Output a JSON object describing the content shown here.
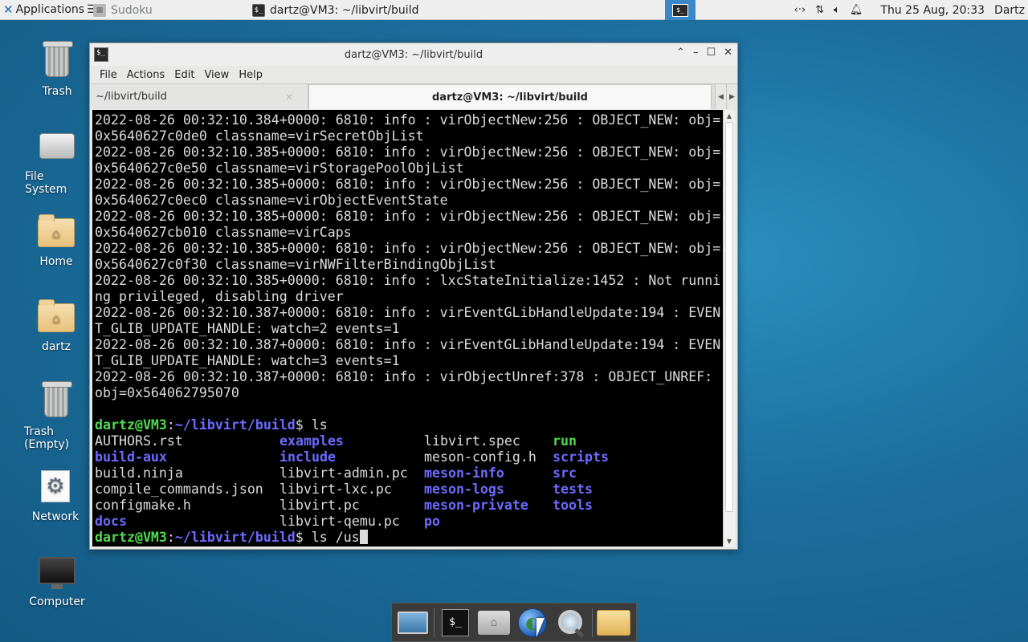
{
  "top_panel": {
    "apps_label": "Applications",
    "apps_suffix": "☰",
    "tasks": [
      {
        "label": "Sudoku",
        "icon": "sudoku-icon",
        "active": false
      },
      {
        "label": "dartz@VM3: ~/libvirt/build",
        "icon": "terminal-icon",
        "active": false
      }
    ],
    "datetime": "Thu 25 Aug, 20:33",
    "user": "Dartz",
    "tray_icons": [
      "network-connections-icon",
      "network-transfer-icon",
      "volume-icon",
      "notification-bell-icon"
    ]
  },
  "desktop_icons": [
    {
      "label": "Trash",
      "icon": "trash-icon"
    },
    {
      "label": "File System",
      "icon": "drive-icon"
    },
    {
      "label": "Home",
      "icon": "home-folder-icon"
    },
    {
      "label": "dartz",
      "icon": "home-folder-icon"
    },
    {
      "label": "Trash (Empty)",
      "icon": "trash-icon"
    },
    {
      "label": "Network",
      "icon": "network-settings-icon"
    },
    {
      "label": "Computer",
      "icon": "monitor-icon"
    }
  ],
  "window": {
    "title": "dartz@VM3: ~/libvirt/build",
    "menu": [
      "File",
      "Actions",
      "Edit",
      "View",
      "Help"
    ],
    "tabs": [
      {
        "label": "~/libvirt/build",
        "active": false
      },
      {
        "label": "dartz@VM3: ~/libvirt/build",
        "active": true
      }
    ]
  },
  "terminal": {
    "log_lines": [
      "2022-08-26 00:32:10.384+0000: 6810: info : virObjectNew:256 : OBJECT_NEW: obj=",
      "0x5640627c0de0 classname=virSecretObjList",
      "2022-08-26 00:32:10.385+0000: 6810: info : virObjectNew:256 : OBJECT_NEW: obj=",
      "0x5640627c0e50 classname=virStoragePoolObjList",
      "2022-08-26 00:32:10.385+0000: 6810: info : virObjectNew:256 : OBJECT_NEW: obj=",
      "0x5640627c0ec0 classname=virObjectEventState",
      "2022-08-26 00:32:10.385+0000: 6810: info : virObjectNew:256 : OBJECT_NEW: obj=",
      "0x5640627cb010 classname=virCaps",
      "2022-08-26 00:32:10.385+0000: 6810: info : virObjectNew:256 : OBJECT_NEW: obj=",
      "0x5640627c0f30 classname=virNWFilterBindingObjList",
      "2022-08-26 00:32:10.385+0000: 6810: info : lxcStateInitialize:1452 : Not runni",
      "ng privileged, disabling driver",
      "2022-08-26 00:32:10.387+0000: 6810: info : virEventGLibHandleUpdate:194 : EVEN",
      "T_GLIB_UPDATE_HANDLE: watch=2 events=1",
      "2022-08-26 00:32:10.387+0000: 6810: info : virEventGLibHandleUpdate:194 : EVEN",
      "T_GLIB_UPDATE_HANDLE: watch=3 events=1",
      "2022-08-26 00:32:10.387+0000: 6810: info : virObjectUnref:378 : OBJECT_UNREF:",
      "obj=0x564062795070",
      ""
    ],
    "prompt_user": "dartz@VM3",
    "prompt_sep": ":",
    "prompt_path": "~/libvirt/build",
    "prompt_end": "$ ",
    "command1": "ls",
    "ls_rows": [
      [
        {
          "t": "AUTHORS.rst",
          "k": "file"
        },
        {
          "t": "examples",
          "k": "dir"
        },
        {
          "t": "libvirt.spec",
          "k": "file"
        },
        {
          "t": "run",
          "k": "exe"
        }
      ],
      [
        {
          "t": "build-aux",
          "k": "dir"
        },
        {
          "t": "include",
          "k": "dir"
        },
        {
          "t": "meson-config.h",
          "k": "file"
        },
        {
          "t": "scripts",
          "k": "dir"
        }
      ],
      [
        {
          "t": "build.ninja",
          "k": "file"
        },
        {
          "t": "libvirt-admin.pc",
          "k": "file"
        },
        {
          "t": "meson-info",
          "k": "dir"
        },
        {
          "t": "src",
          "k": "dir"
        }
      ],
      [
        {
          "t": "compile_commands.json",
          "k": "file"
        },
        {
          "t": "libvirt-lxc.pc",
          "k": "file"
        },
        {
          "t": "meson-logs",
          "k": "dir"
        },
        {
          "t": "tests",
          "k": "dir"
        }
      ],
      [
        {
          "t": "configmake.h",
          "k": "file"
        },
        {
          "t": "libvirt.pc",
          "k": "file"
        },
        {
          "t": "meson-private",
          "k": "dir"
        },
        {
          "t": "tools",
          "k": "dir"
        }
      ],
      [
        {
          "t": "docs",
          "k": "dir"
        },
        {
          "t": "libvirt-qemu.pc",
          "k": "file"
        },
        {
          "t": "po",
          "k": "dir"
        },
        {
          "t": "",
          "k": "file"
        }
      ]
    ],
    "command2": "ls /us"
  },
  "dock": {
    "items": [
      "show-desktop-icon",
      "terminal-icon",
      "home-folder-icon",
      "web-browser-icon",
      "search-icon",
      "folder-icon"
    ]
  },
  "colors": {
    "prompt_green": "#4edb4e",
    "dir_blue": "#6b6bff",
    "desktop_blue": "#1c6e9d"
  }
}
